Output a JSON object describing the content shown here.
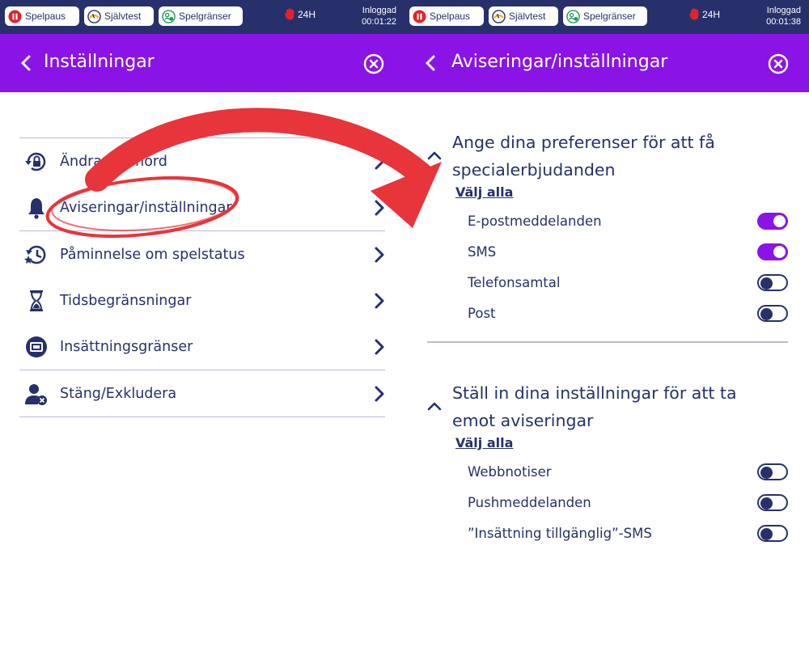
{
  "colors": {
    "topbar": "#27306b",
    "header": "#8a14e6",
    "text": "#27306b",
    "toggle_on": "#8a14e6",
    "annotation": "#e8343b"
  },
  "status_bar": {
    "spelpaus_label": "Spelpaus",
    "sjalvtest_label": "Självtest",
    "spelgranser_label": "Spelgränser",
    "limit_label": "24H",
    "logged_in_label": "Inloggad"
  },
  "left": {
    "timer": "00:01:22",
    "header_title": "Inställningar",
    "menu": [
      {
        "label": "Ändra lösenord",
        "icon": "lock-reset-icon"
      },
      {
        "label": "Aviseringar/inställningar",
        "icon": "bell-icon"
      },
      {
        "label": "Påminnelse om spelstatus",
        "icon": "clock-history-icon"
      },
      {
        "label": "Tidsbegränsningar",
        "icon": "hourglass-icon"
      },
      {
        "label": "Insättningsgränser",
        "icon": "deposit-limit-icon"
      },
      {
        "label": "Stäng/Exkludera",
        "icon": "user-exclude-icon"
      }
    ]
  },
  "right": {
    "timer": "00:01:38",
    "header_title": "Aviseringar/inställningar",
    "sections": [
      {
        "title": "Ange dina preferenser för att få specialerbjudanden",
        "select_all": "Välj alla",
        "options": [
          {
            "label": "E-postmeddelanden",
            "enabled": true
          },
          {
            "label": "SMS",
            "enabled": true
          },
          {
            "label": "Telefonsamtal",
            "enabled": false
          },
          {
            "label": "Post",
            "enabled": false
          }
        ]
      },
      {
        "title": "Ställ in dina inställningar för att ta emot aviseringar",
        "select_all": "Välj alla",
        "options": [
          {
            "label": "Webbnotiser",
            "enabled": false
          },
          {
            "label": "Pushmeddelanden",
            "enabled": false
          },
          {
            "label": "”Insättning tillgänglig”-SMS",
            "enabled": false
          }
        ]
      }
    ]
  }
}
